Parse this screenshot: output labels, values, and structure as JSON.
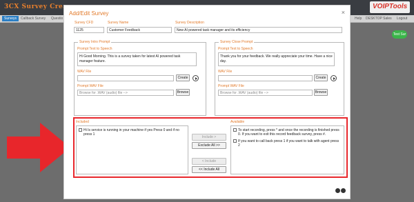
{
  "app": {
    "logo_text": "3CX Survey Crea",
    "vt_logo": "VOIPTools",
    "nav": [
      {
        "label": "Surveys",
        "active": true
      },
      {
        "label": "Callback Survey",
        "active": false
      },
      {
        "label": "Questio",
        "active": false
      }
    ],
    "right_nav": [
      "Help",
      "DESKTOP Sales",
      "Logout"
    ],
    "test_button": "Test Sur"
  },
  "modal": {
    "title": "Add/Edit Survey",
    "close_label": "×",
    "survey_cfd_label": "Survey CFD",
    "survey_cfd_value": "1125",
    "survey_name_label": "Survey Name",
    "survey_name_value": "Customer Feedback",
    "survey_desc_label": "Survey Description",
    "survey_desc_value": "New AI powered task manager and its efficiency",
    "intro": {
      "legend": "Survey Intro Prompt",
      "tts_label": "Prompt Text to Speech",
      "tts_value": "Hi Good Morning. This is a survey taken for latest AI powered task manager feature.",
      "wav_label": "WAV File",
      "wav_value": "",
      "create_label": "Create",
      "prompt_wav_label": "Prompt WAV File",
      "prompt_wav_placeholder": "Browse for .WAV (audio) file -->",
      "browse_label": "Browse"
    },
    "close": {
      "legend": "Survey Close Prompt",
      "tts_label": "Prompt Text to Speech",
      "tts_value": "Thank you for your feedback. We really appreciate your time. Have a nice day.",
      "wav_label": "WAV File",
      "wav_value": "",
      "create_label": "Create",
      "prompt_wav_label": "Prompt WAV File",
      "prompt_wav_placeholder": "Browse for .WAV (audio) file -->",
      "browse_label": "Browse"
    },
    "included": {
      "label": "Included",
      "items": [
        "Hi Is service is running in your machine if yes Press 0 and if no press 1"
      ]
    },
    "available": {
      "label": "Available",
      "items": [
        "To start recording, press * and once the recording is finished press 0. If you want to exit this record feedback survey, press #.",
        "If you want to call back press 1 if you want to talk with agent press 2"
      ]
    },
    "buttons": {
      "include": "Include >",
      "exclude_all": "Exclude All >>",
      "exclude": "< Include",
      "include_all": "<< Include All"
    }
  },
  "colors": {
    "accent": "#e27a2a",
    "highlight": "#e8262b",
    "arrow": "#e8262b"
  }
}
